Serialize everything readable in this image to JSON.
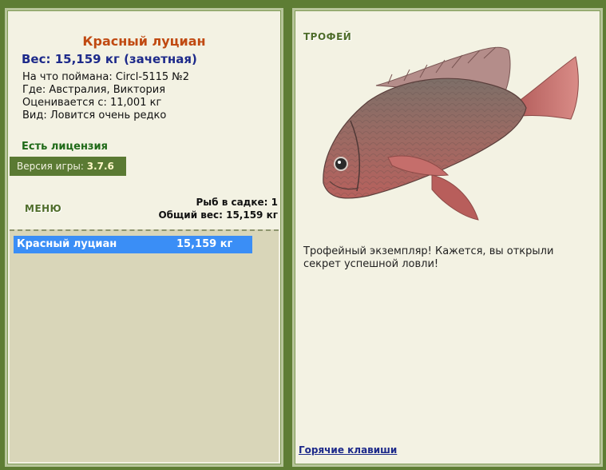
{
  "fish": {
    "name": "Красный луциан",
    "weight_line": "Вес: 15,159 кг (зачетная)",
    "caught_on": "На что поймана: Circl-5115 №2",
    "where": "Где: Австралия, Виктория",
    "valued_from": "Оценивается с: 11,001 кг",
    "kind": "Вид: Ловится очень редко"
  },
  "license": "Есть лицензия",
  "version": {
    "label": "Версия игры:",
    "value": "3.7.6"
  },
  "menu_label": "МЕНЮ",
  "keepnet": {
    "count_line": "Рыб в садке: 1",
    "total_line": "Общий вес: 15,159 кг",
    "items": [
      {
        "name": "Красный луциан",
        "weight": "15,159 кг"
      }
    ]
  },
  "trophy": {
    "title": "ТРОФЕЙ",
    "text": "Трофейный экземпляр! Кажется, вы открыли секрет успешной ловли!"
  },
  "hotkeys_link": "Горячие клавиши",
  "colors": {
    "background": "#5e7d34",
    "panel": "#f3f2e3",
    "selection": "#3a8ef6",
    "fish_name": "#c04a12",
    "weight": "#1d2a8a"
  }
}
